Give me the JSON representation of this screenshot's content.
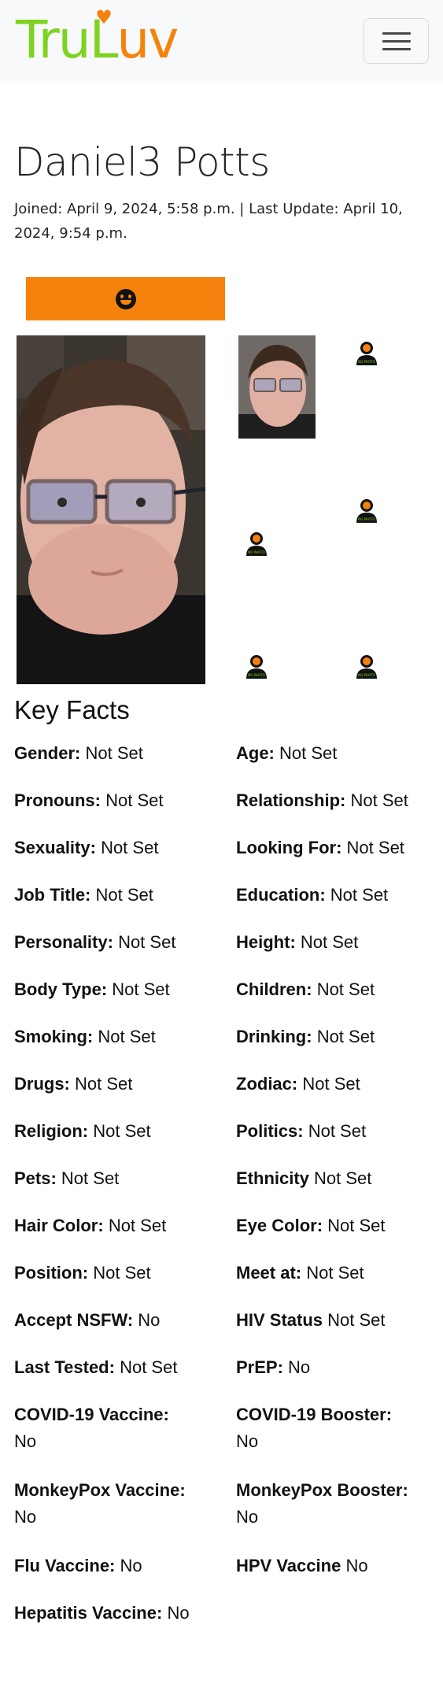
{
  "brand": {
    "part1": "Tru",
    "part2": "L",
    "part3": "uv"
  },
  "profile": {
    "name": "Daniel3 Potts",
    "joined_line": "Joined: April 9, 2024, 5:58 p.m. | Last Update: April 10, 2024, 9:54 p.m."
  },
  "colors": {
    "brand_green": "#7ed321",
    "brand_orange": "#f5820d"
  },
  "icons": {
    "menu": "hamburger-icon",
    "smile": "smile-icon",
    "no_photo": "no-photo-placeholder-icon",
    "no_photo_label": "NO PHOTO"
  },
  "key_facts": {
    "title": "Key Facts",
    "items": [
      {
        "label": "Gender:",
        "value": "Not Set"
      },
      {
        "label": "Age:",
        "value": "Not Set"
      },
      {
        "label": "Pronouns:",
        "value": "Not Set"
      },
      {
        "label": "Relationship:",
        "value": "Not Set"
      },
      {
        "label": "Sexuality:",
        "value": "Not Set"
      },
      {
        "label": "Looking For:",
        "value": "Not Set"
      },
      {
        "label": "Job Title:",
        "value": "Not Set"
      },
      {
        "label": "Education:",
        "value": "Not Set"
      },
      {
        "label": "Personality:",
        "value": "Not Set"
      },
      {
        "label": "Height:",
        "value": "Not Set"
      },
      {
        "label": "Body Type:",
        "value": "Not Set"
      },
      {
        "label": "Children:",
        "value": "Not Set"
      },
      {
        "label": "Smoking:",
        "value": "Not Set"
      },
      {
        "label": "Drinking:",
        "value": "Not Set"
      },
      {
        "label": "Drugs:",
        "value": "Not Set"
      },
      {
        "label": "Zodiac:",
        "value": "Not Set"
      },
      {
        "label": "Religion:",
        "value": "Not Set"
      },
      {
        "label": "Politics:",
        "value": "Not Set"
      },
      {
        "label": "Pets:",
        "value": "Not Set"
      },
      {
        "label": "Ethnicity",
        "value": "Not Set"
      },
      {
        "label": "Hair Color:",
        "value": "Not Set"
      },
      {
        "label": "Eye Color:",
        "value": "Not Set"
      },
      {
        "label": "Position:",
        "value": "Not Set"
      },
      {
        "label": "Meet at:",
        "value": "Not Set"
      },
      {
        "label": "Accept NSFW:",
        "value": "No"
      },
      {
        "label": "HIV Status",
        "value": "Not Set"
      },
      {
        "label": "Last Tested:",
        "value": "Not Set"
      },
      {
        "label": "PrEP:",
        "value": "No"
      },
      {
        "label": "COVID-19 Vaccine:",
        "value": "No"
      },
      {
        "label": "COVID-19 Booster:",
        "value": "No"
      },
      {
        "label": "MonkeyPox Vaccine:",
        "value": "No"
      },
      {
        "label": "MonkeyPox Booster:",
        "value": "No"
      },
      {
        "label": "Flu Vaccine:",
        "value": "No"
      },
      {
        "label": "HPV Vaccine",
        "value": "No"
      },
      {
        "label": "Hepatitis Vaccine:",
        "value": "No"
      }
    ]
  }
}
